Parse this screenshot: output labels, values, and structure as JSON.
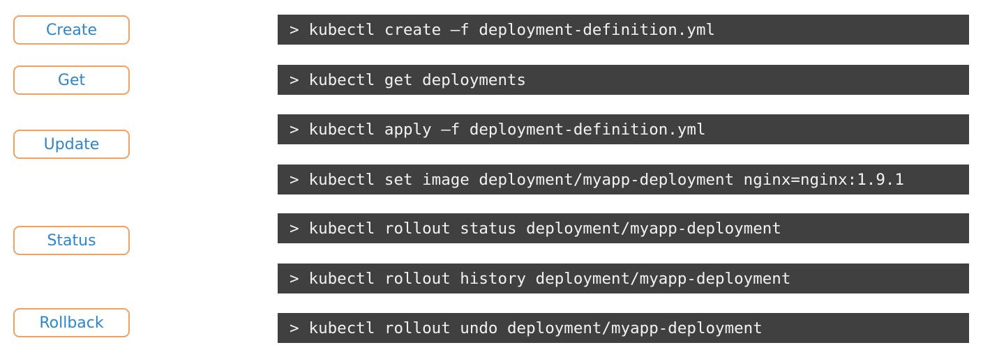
{
  "labels": {
    "create": "Create",
    "get": "Get",
    "update": "Update",
    "status": "Status",
    "rollback": "Rollback"
  },
  "prompt": ">",
  "commands": {
    "create": "kubectl create –f deployment-definition.yml",
    "get": "kubectl get deployments",
    "apply": "kubectl apply –f deployment-definition.yml",
    "set_image": "kubectl set image deployment/myapp-deployment nginx=nginx:1.9.1",
    "rollout_status": "kubectl rollout status deployment/myapp-deployment",
    "rollout_history": "kubectl rollout history deployment/myapp-deployment",
    "rollout_undo": "kubectl rollout undo deployment/myapp-deployment"
  },
  "colors": {
    "label_border": "#f0a060",
    "label_text": "#2e86c8",
    "command_background": "#404040",
    "command_text": "#f2f2f2"
  }
}
